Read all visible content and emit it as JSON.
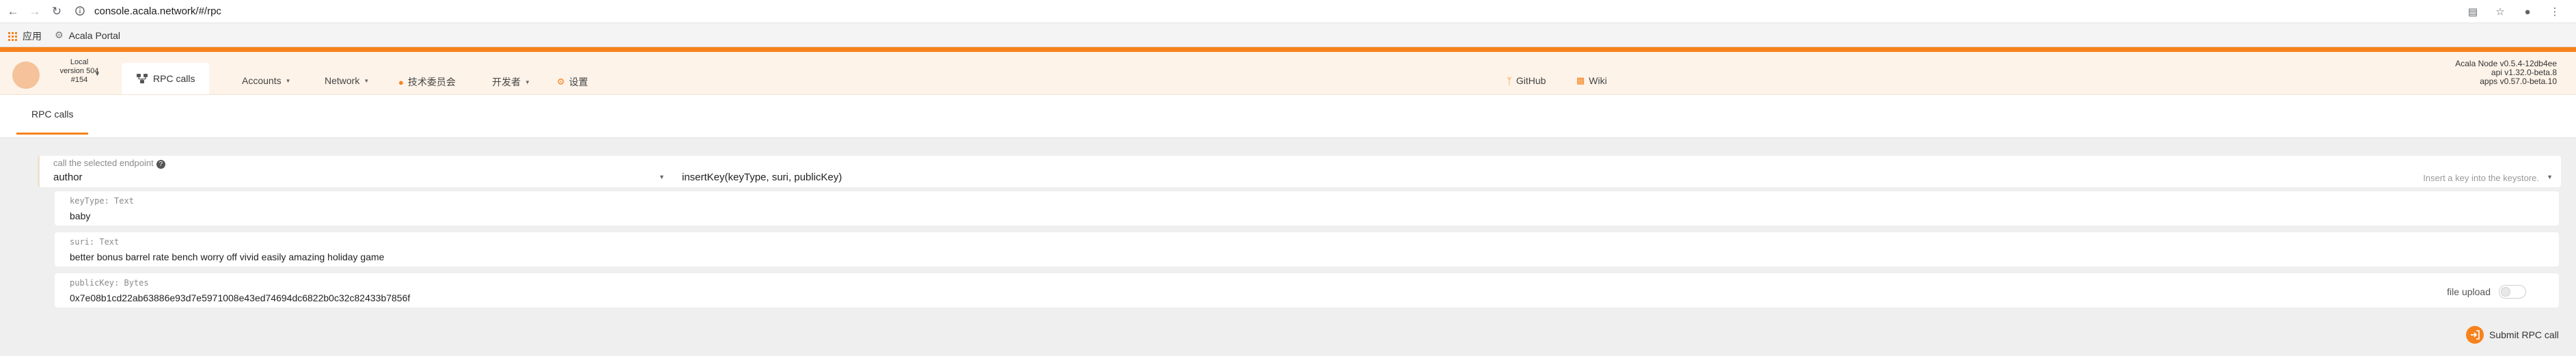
{
  "browser": {
    "url": "console.acala.network/#/rpc",
    "bookmarks": [
      {
        "label": "应用",
        "icon": "apps-grid-icon"
      },
      {
        "label": "Acala Portal",
        "icon": "gear-icon"
      }
    ]
  },
  "header": {
    "chain": {
      "name": "Local",
      "version": "version 504",
      "block": "#154"
    },
    "active_tab": "RPC calls",
    "menu": [
      {
        "label": "Accounts",
        "has_caret": true
      },
      {
        "label": "Network",
        "has_caret": true
      },
      {
        "label": "技术委员会",
        "has_caret": false
      },
      {
        "label": "开发者",
        "has_caret": true
      },
      {
        "label": "设置",
        "has_caret": false
      }
    ],
    "links": {
      "github": "GitHub",
      "wiki": "Wiki"
    },
    "node_info": {
      "node": "Acala Node v0.5.4-12db4ee",
      "api": "api v1.32.0-beta.8",
      "apps": "apps v0.57.0-beta.10"
    }
  },
  "subheader": {
    "tab": "RPC calls"
  },
  "endpoint": {
    "label": "call the selected endpoint",
    "section": "author",
    "method": "insertKey(keyType, suri, publicKey)",
    "description": "Insert a key into the keystore."
  },
  "params": [
    {
      "label": "keyType: Text",
      "value": "baby"
    },
    {
      "label": "suri: Text",
      "value": "better bonus barrel rate bench worry off vivid easily amazing holiday game"
    },
    {
      "label": "publicKey: Bytes",
      "value": "0x7e08b1cd22ab63886e93d7e5971008e43ed74694dc6822b0c32c82433b7856f"
    }
  ],
  "file_upload": {
    "label": "file upload",
    "enabled": false
  },
  "submit": {
    "label": "Submit RPC call"
  },
  "colors": {
    "accent": "#f7821d",
    "header_bg": "#fdf3e9",
    "page_bg": "#efefef"
  }
}
